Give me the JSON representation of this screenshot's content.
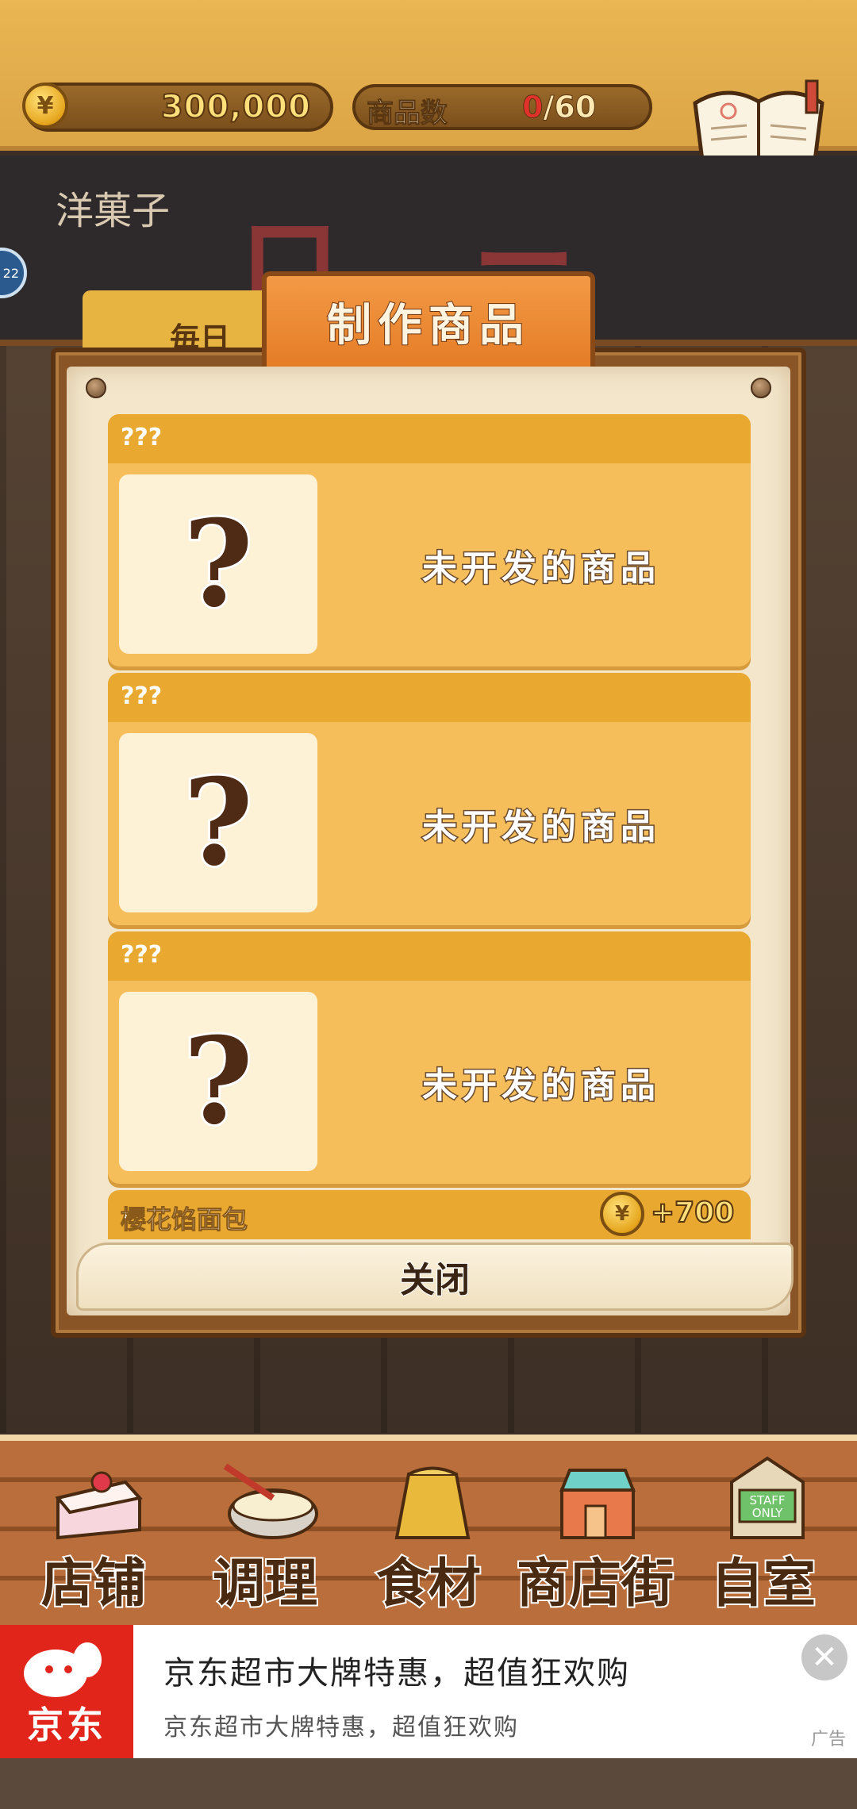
{
  "header": {
    "money_value": "300,000",
    "currency_symbol": "¥",
    "goods_label": "商品数",
    "goods_current": "0",
    "goods_separator": "/",
    "goods_max": "60",
    "recipe_label": "食谱"
  },
  "background": {
    "shop_sign_small": "洋菓子",
    "shop_sign_big": "ロ ー ブ",
    "daily_tab": "毎日",
    "side_badge": "22"
  },
  "modal": {
    "title": "制作商品",
    "cards": [
      {
        "header": "???",
        "placeholder_symbol": "?",
        "status": "未开发的商品"
      },
      {
        "header": "???",
        "placeholder_symbol": "?",
        "status": "未开发的商品"
      },
      {
        "header": "???",
        "placeholder_symbol": "?",
        "status": "未开发的商品"
      }
    ],
    "partial_card": {
      "name": "樱花馅面包",
      "price": "+700",
      "currency_symbol": "¥"
    },
    "close_label": "关闭"
  },
  "bottom_nav": {
    "items": [
      {
        "label": "店铺",
        "icon": "cake-icon"
      },
      {
        "label": "调理",
        "icon": "mixing-bowl-icon"
      },
      {
        "label": "食材",
        "icon": "flour-bag-icon"
      },
      {
        "label": "商店街",
        "icon": "shop-street-icon"
      },
      {
        "label": "自室",
        "icon": "staff-door-icon"
      }
    ]
  },
  "ad": {
    "brand": "京东",
    "title": "京东超市大牌特惠，超值狂欢购",
    "subtitle": "京东超市大牌特惠，超值狂欢购",
    "tag": "广告",
    "close_symbol": "✕"
  },
  "colors": {
    "header_bg": "#dca546",
    "card_bg": "#f5be5a",
    "card_header": "#e9a931",
    "modal_tab": "#e57c26",
    "ad_brand": "#e1251b"
  }
}
